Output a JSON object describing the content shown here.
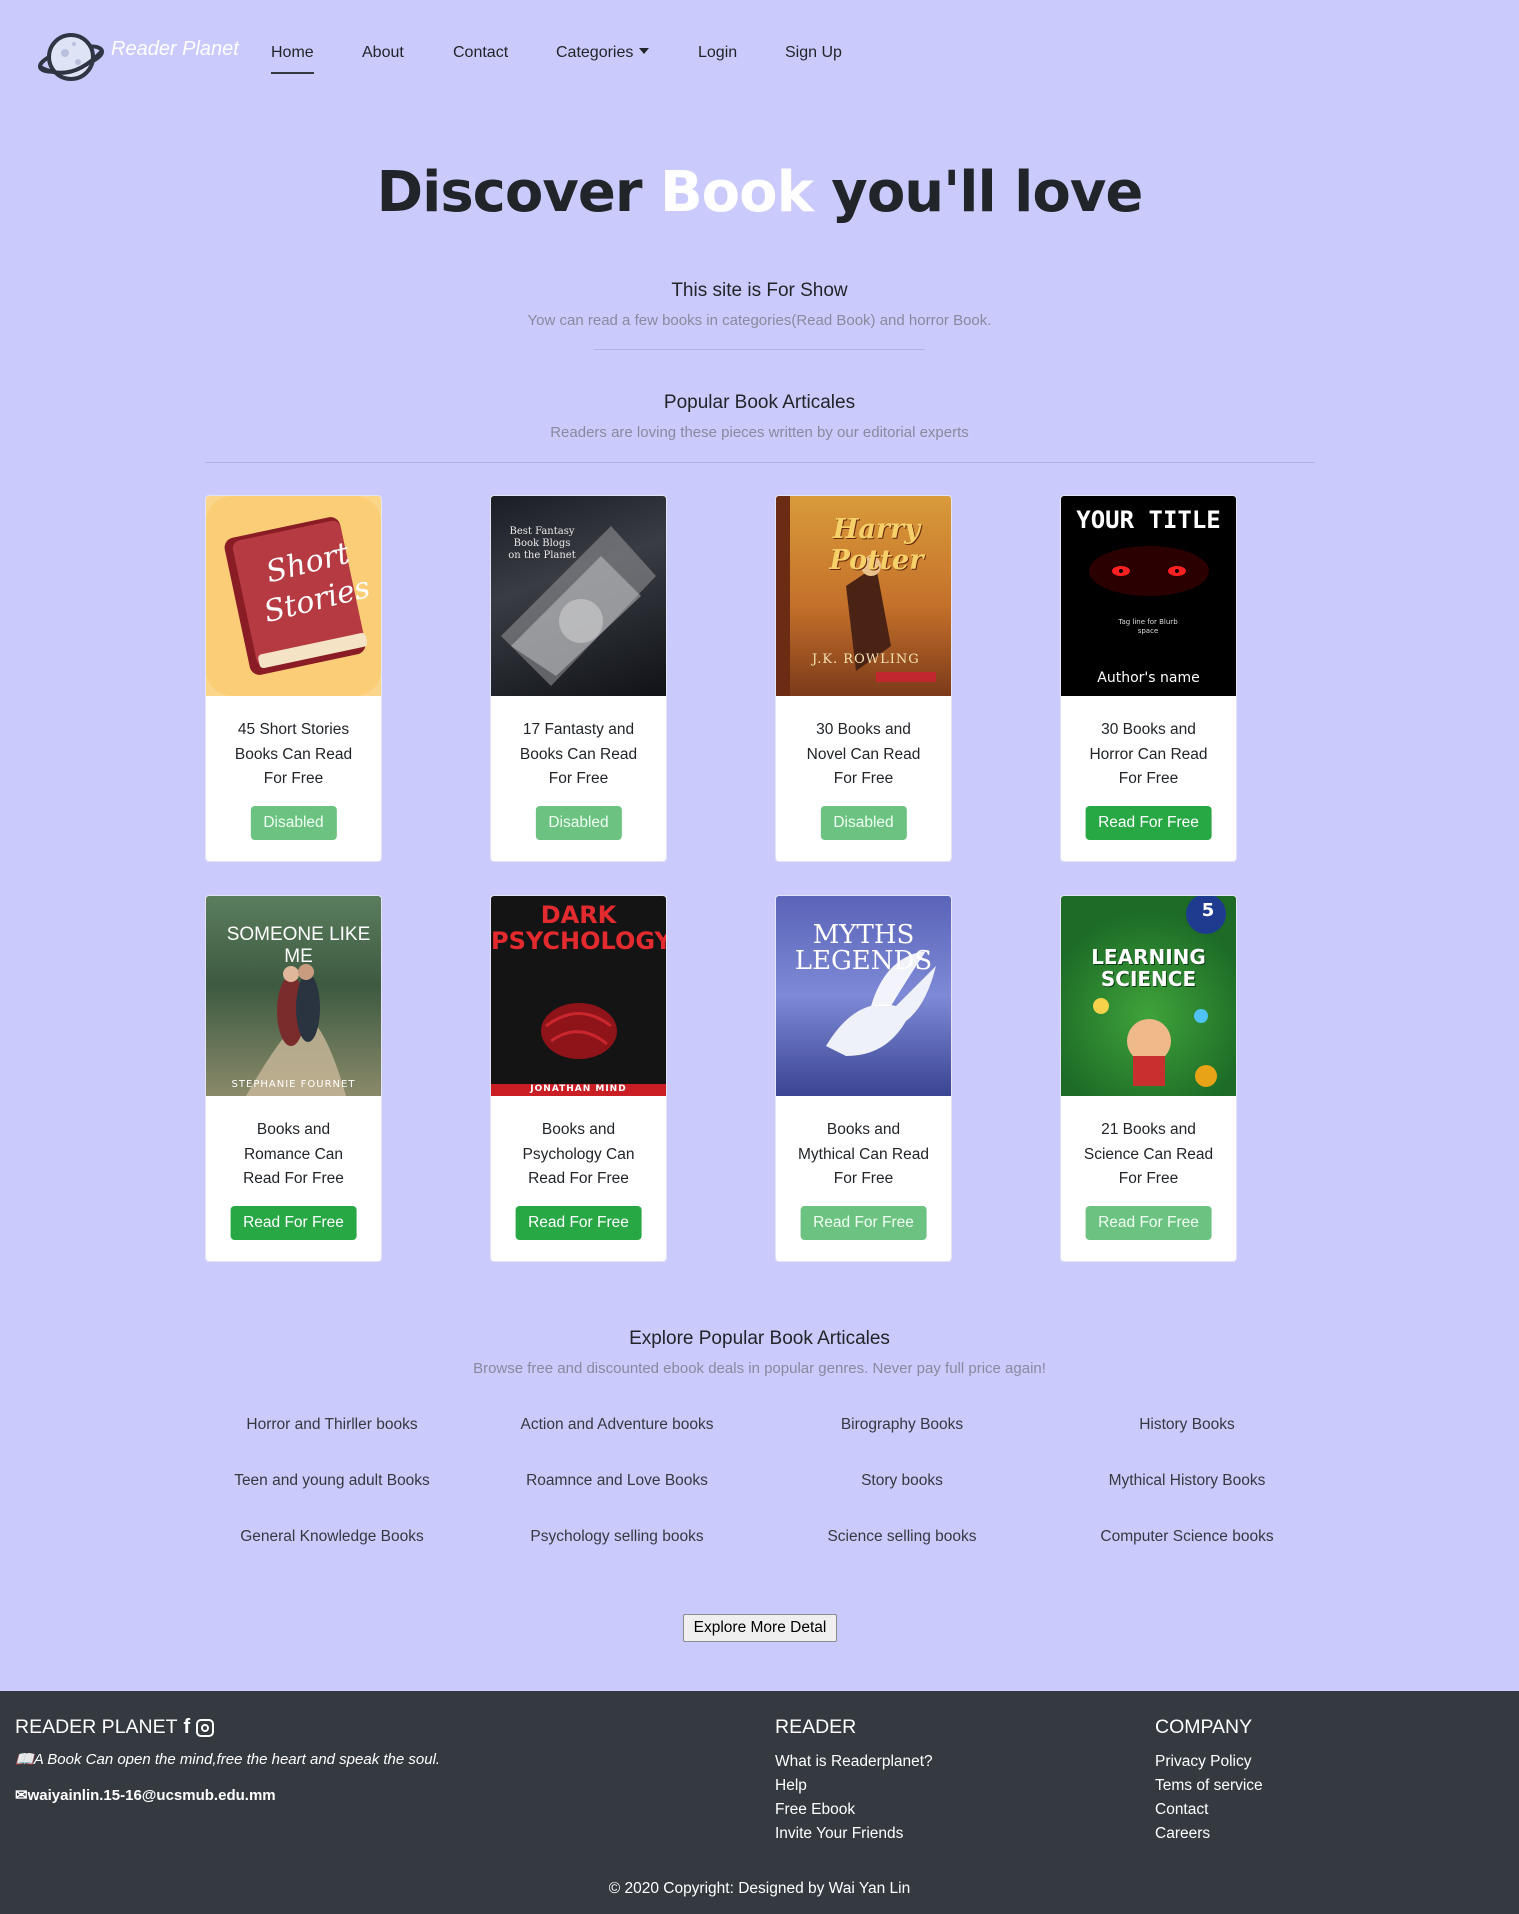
{
  "nav": {
    "brand": "Reader Planet",
    "items": [
      {
        "label": "Home"
      },
      {
        "label": "About"
      },
      {
        "label": "Contact"
      },
      {
        "label": "Categories"
      },
      {
        "label": "Login"
      },
      {
        "label": "Sign Up"
      }
    ]
  },
  "hero": {
    "title_pre": "Discover ",
    "title_highlight": "Book",
    "title_post": " you'll love",
    "subtitle": "This site is For Show",
    "subtext": "Yow can read a few books in categories(Read Book) and horror Book."
  },
  "popular": {
    "heading": "Popular Book Articales",
    "subtext": "Readers are loving these pieces written by our editorial experts",
    "cards": [
      {
        "line1": "45 Short Stories",
        "line2": "Books Can Read",
        "line3": "For Free",
        "button": "Disabled",
        "cover_text": "Short Stories"
      },
      {
        "line1": "17 Fantasty and",
        "line2": "Books Can Read",
        "line3": "For Free",
        "button": "Disabled",
        "cover_text": "Best Fantasy Book Blogs on the Planet"
      },
      {
        "line1": "30 Books and",
        "line2": "Novel Can Read",
        "line3": "For Free",
        "button": "Disabled",
        "cover_text": "Harry Potter",
        "cover_sub": "J.K. ROWLING"
      },
      {
        "line1": "30 Books and",
        "line2": "Horror Can Read",
        "line3": "For Free",
        "button": "Read For Free",
        "cover_text": "YOUR TITLE",
        "cover_sub": "Author's name",
        "cover_tag": "Tag line for Blurb space"
      },
      {
        "line1": "Books and",
        "line2": "Romance Can",
        "line3": "Read For Free",
        "button": "Read For Free",
        "cover_text": "SOMEONE LIKE ME",
        "cover_sub": "STEPHANIE FOURNET"
      },
      {
        "line1": "Books and",
        "line2": "Psychology Can",
        "line3": "Read For Free",
        "button": "Read For Free",
        "cover_text": "DARK PSYCHOLOGY",
        "cover_sub": "JONATHAN MIND"
      },
      {
        "line1": "Books and",
        "line2": "Mythical Can Read",
        "line3": "For Free",
        "button": "Read For Free",
        "cover_text": "MYTHS LEGENDS"
      },
      {
        "line1": "21 Books and",
        "line2": "Science Can Read",
        "line3": "For Free",
        "button": "Read For Free",
        "cover_text": "LEARNING SCIENCE",
        "cover_sub": "5"
      }
    ]
  },
  "explore": {
    "heading": "Explore Popular Book Articales",
    "subtext": "Browse free and discounted ebook deals in popular genres. Never pay full price again!",
    "links": [
      "Horror and Thirller books",
      "Action and Adventure books",
      "Birography Books",
      "History Books",
      "Teen and young adult Books",
      "Roamnce and Love Books",
      "Story books",
      "Mythical History Books",
      "General Knowledge Books",
      "Psychology selling books",
      "Science selling books",
      "Computer Science books"
    ],
    "button": "Explore More Detal"
  },
  "footer": {
    "brand": "READER PLANET",
    "tagline": "A Book Can open the mind,free the heart and speak the soul.",
    "email": "waiyainlin.15-16@ucsmub.edu.mm",
    "reader_title": "READER",
    "reader_links": [
      "What is Readerplanet?",
      "Help",
      "Free Ebook",
      "Invite Your Friends"
    ],
    "company_title": "COMPANY",
    "company_links": [
      "Privacy Policy",
      "Tems of service",
      "Contact",
      "Careers"
    ],
    "copyright": "© 2020 Copyright: Designed by Wai Yan Lin"
  },
  "colors": {
    "background": "#cbcafc",
    "footer": "#343a40",
    "button_green": "#28a745",
    "button_disabled": "#6cc381"
  }
}
